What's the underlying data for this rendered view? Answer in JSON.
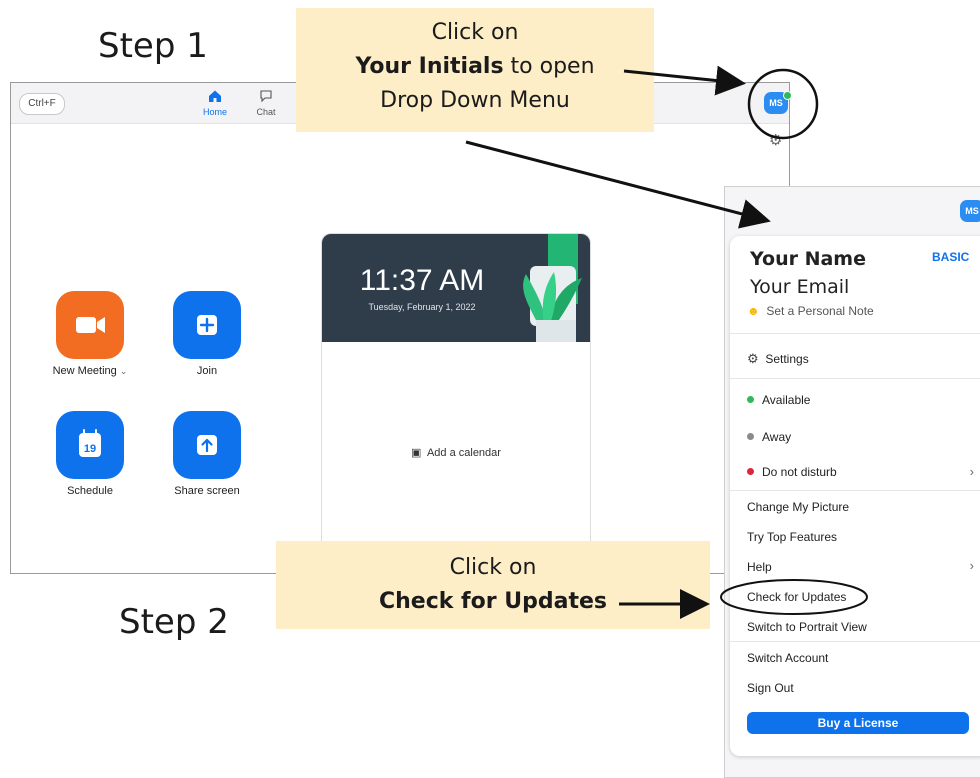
{
  "steps": {
    "step1": "Step 1",
    "step2": "Step 2"
  },
  "callouts": {
    "c1_line1": "Click on",
    "c1_bold": "Your Initials",
    "c1_rest": " to open",
    "c1_line3": "Drop Down Menu",
    "c2_line1": "Click on",
    "c2_bold": "Check for Updates"
  },
  "zoom": {
    "shortcut": "Ctrl+F",
    "tabs": [
      {
        "label": "Home",
        "icon": "home-icon"
      },
      {
        "label": "Chat",
        "icon": "chat-icon"
      }
    ],
    "avatar_initials": "MS",
    "actions": [
      {
        "label": "New Meeting",
        "icon": "video-camera-icon",
        "color": "#f26d21"
      },
      {
        "label": "Join",
        "icon": "plus-icon",
        "color": "#0e72ed"
      },
      {
        "label": "Schedule",
        "icon": "calendar-icon",
        "calendar_day": "19",
        "color": "#0e72ed"
      },
      {
        "label": "Share screen",
        "icon": "share-up-arrow-icon",
        "color": "#0e72ed"
      }
    ],
    "calendar_card": {
      "time": "11:37 AM",
      "date": "Tuesday, February 1, 2022",
      "add_calendar": "Add a calendar"
    }
  },
  "dropdown": {
    "avatar_initials": "MS",
    "name": "Your Name",
    "email": "Your Email",
    "plan_badge": "BASIC",
    "personal_note": "Set a Personal Note",
    "settings": "Settings",
    "statuses": [
      {
        "label": "Available",
        "color": "#2dbb5a"
      },
      {
        "label": "Away",
        "color": "#8a8a8a"
      },
      {
        "label": "Do not disturb",
        "color": "#e0243c"
      }
    ],
    "items": [
      "Change My Picture",
      "Try Top Features",
      "Help",
      "Check for Updates",
      "Switch to Portrait View",
      "Switch Account",
      "Sign Out"
    ],
    "buy_button": "Buy a License"
  },
  "colors": {
    "accent": "#0e72ed",
    "callout_bg": "#fdeec7",
    "orange": "#f26d21"
  }
}
